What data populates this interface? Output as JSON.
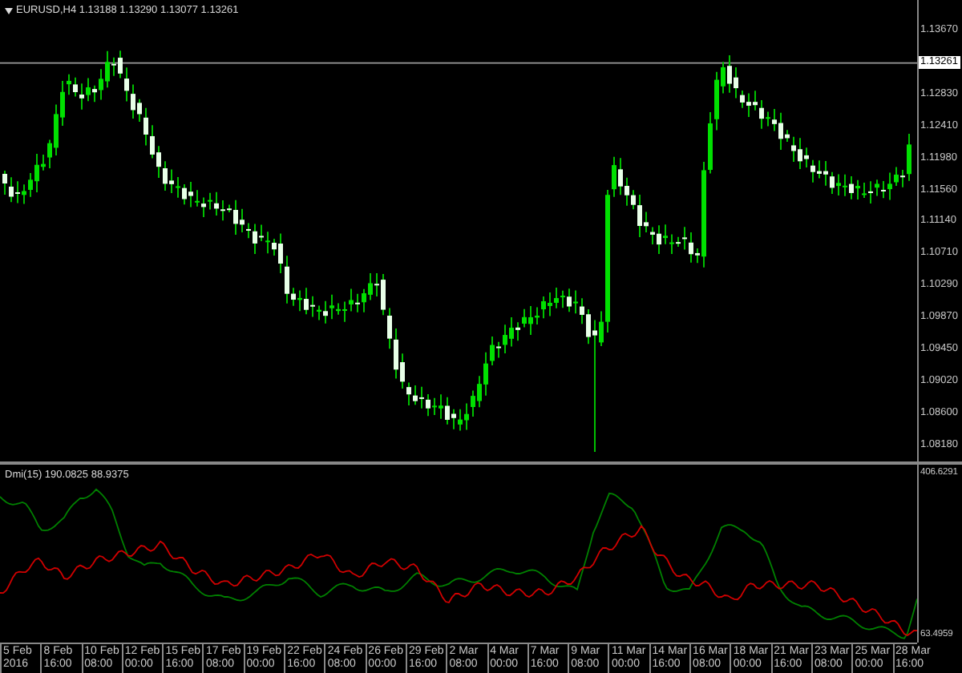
{
  "chart": {
    "title": "EURUSD,H4 1.13188 1.13290 1.13077 1.13261",
    "price_axis": [
      {
        "text": "1.13670",
        "kind": "tick"
      },
      {
        "text": "1.13261",
        "kind": "current"
      },
      {
        "text": "1.12830",
        "kind": "tick"
      },
      {
        "text": "1.12410",
        "kind": "tick"
      },
      {
        "text": "1.11980",
        "kind": "tick"
      },
      {
        "text": "1.11560",
        "kind": "tick"
      },
      {
        "text": "1.11140",
        "kind": "tick"
      },
      {
        "text": "1.10710",
        "kind": "tick"
      },
      {
        "text": "1.10290",
        "kind": "tick"
      },
      {
        "text": "1.09870",
        "kind": "tick"
      },
      {
        "text": "1.09450",
        "kind": "tick"
      },
      {
        "text": "1.09020",
        "kind": "tick"
      },
      {
        "text": "1.08600",
        "kind": "tick"
      },
      {
        "text": "1.08180",
        "kind": "tick"
      }
    ],
    "indicator": {
      "title": "Dmi(15) 190.0825 88.9375",
      "axis": [
        "406.6291",
        "63.4959"
      ]
    },
    "time_axis": [
      "5 Feb 2016",
      "8 Feb 16:00",
      "10 Feb 08:00",
      "12 Feb 00:00",
      "15 Feb 16:00",
      "17 Feb 08:00",
      "19 Feb 00:00",
      "22 Feb 16:00",
      "24 Feb 08:00",
      "26 Feb 00:00",
      "29 Feb 16:00",
      "2 Mar 08:00",
      "4 Mar 00:00",
      "7 Mar 16:00",
      "9 Mar 08:00",
      "11 Mar 00:00",
      "14 Mar 16:00",
      "16 Mar 08:00",
      "18 Mar 00:00",
      "21 Mar 16:00",
      "23 Mar 08:00",
      "25 Mar 00:00",
      "28 Mar 16:00"
    ]
  }
}
